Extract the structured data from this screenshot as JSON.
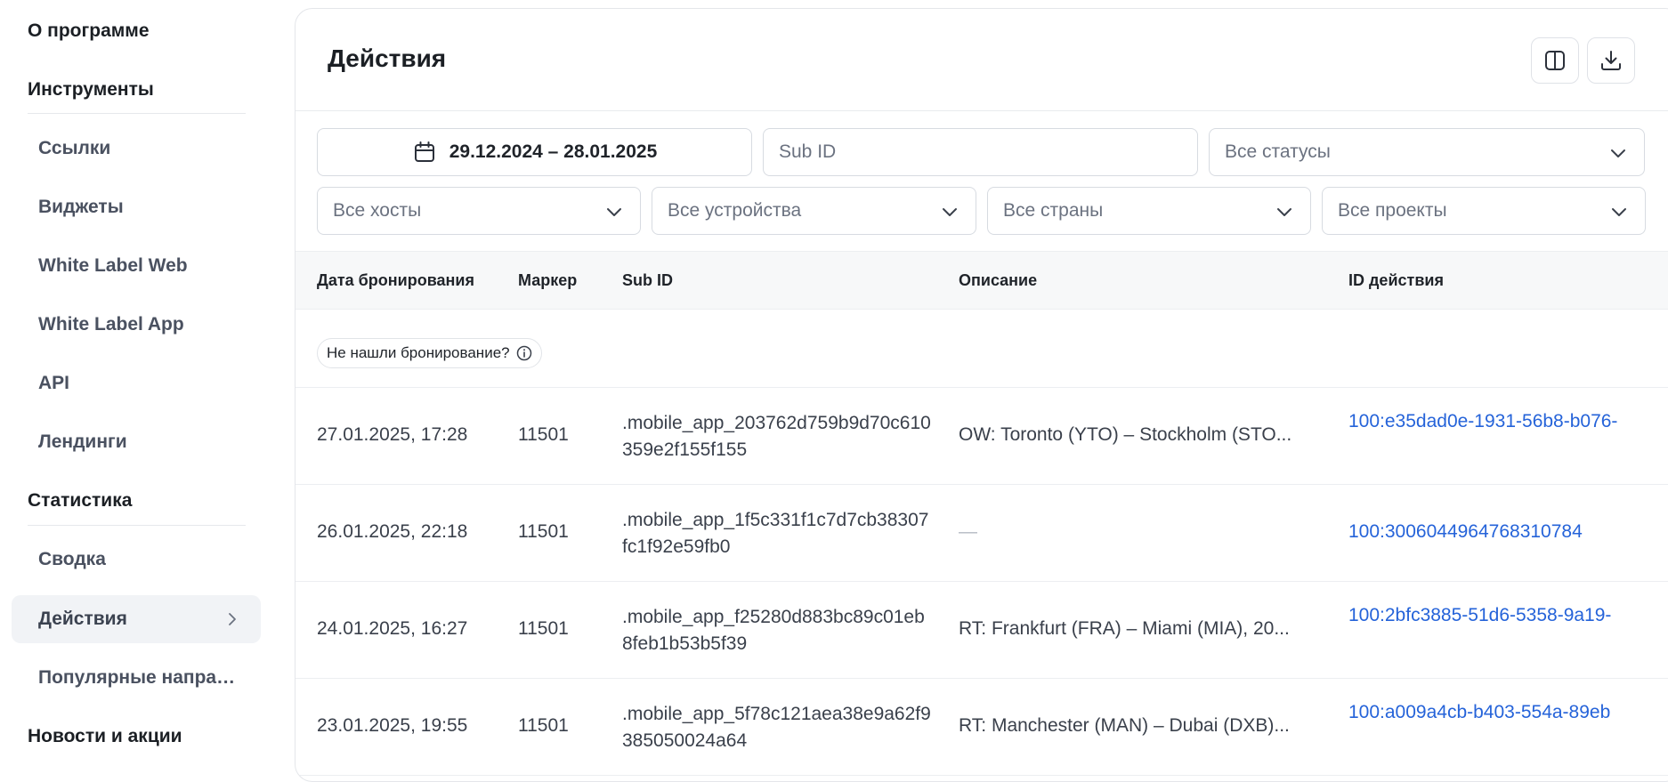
{
  "sidebar": {
    "about": "О программе",
    "tools_heading": "Инструменты",
    "tools": [
      "Ссылки",
      "Виджеты",
      "White Label Web",
      "White Label App",
      "API",
      "Лендинги"
    ],
    "stats_heading": "Статистика",
    "stats": [
      "Сводка",
      "Действия",
      "Популярные направления"
    ],
    "news_heading": "Новости и акции",
    "active_item": "Действия"
  },
  "page": {
    "title": "Действия"
  },
  "toolbar": {
    "columns_icon": "columns-icon",
    "download_icon": "download-icon"
  },
  "filters": {
    "date_range": "29.12.2024 – 28.01.2025",
    "sub_id_placeholder": "Sub ID",
    "status": "Все статусы",
    "hosts": "Все хосты",
    "devices": "Все устройства",
    "countries": "Все страны",
    "projects": "Все проекты"
  },
  "table": {
    "columns": [
      "Дата бронирования",
      "Маркер",
      "Sub ID",
      "Описание",
      "ID действия"
    ],
    "notice": "Не нашли бронирование?",
    "rows": [
      {
        "date": "27.01.2025, 17:28",
        "marker": "11501",
        "sub_id": ".mobile_app_203762d759b9d70c610359e2f155f155",
        "description": "OW: Toronto (YTO) – Stockholm (STO...",
        "action_id": "100:e35dad0e-1931-56b8-b076-"
      },
      {
        "date": "26.01.2025, 22:18",
        "marker": "11501",
        "sub_id": ".mobile_app_1f5c331f1c7d7cb38307fc1f92e59fb0",
        "description": "—",
        "action_id": "100:3006044964768310784"
      },
      {
        "date": "24.01.2025, 16:27",
        "marker": "11501",
        "sub_id": ".mobile_app_f25280d883bc89c01eb8feb1b53b5f39",
        "description": "RT: Frankfurt (FRA) – Miami (MIA), 20...",
        "action_id": "100:2bfc3885-51d6-5358-9a19-"
      },
      {
        "date": "23.01.2025, 19:55",
        "marker": "11501",
        "sub_id": ".mobile_app_5f78c121aea38e9a62f9385050024a64",
        "description": "RT: Manchester (MAN) – Dubai (DXB)...",
        "action_id": "100:a009a4cb-b403-554a-89eb"
      }
    ]
  },
  "colors": {
    "link": "#2563d9",
    "active_bg": "#f1f3f6",
    "border": "#d7dbe1"
  }
}
